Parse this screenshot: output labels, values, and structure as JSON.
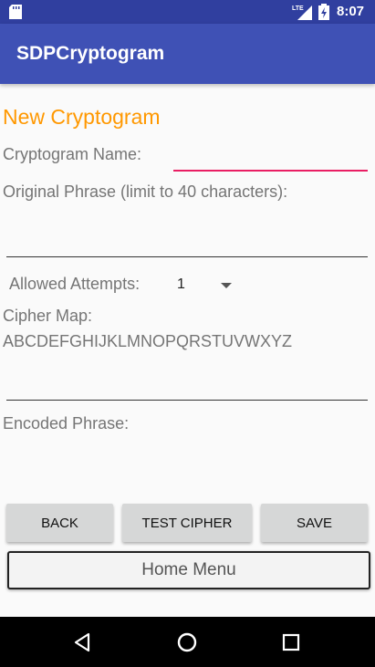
{
  "status_bar": {
    "time": "8:07",
    "icons": [
      "sd-card-icon",
      "lte-signal-icon",
      "battery-icon"
    ],
    "background": "#303f9f"
  },
  "app_bar": {
    "title": "SDPCryptogram",
    "background": "#3f51b5"
  },
  "form": {
    "title": "New Cryptogram",
    "title_color": "#ff9800",
    "name_label": "Cryptogram Name:",
    "name_value": "",
    "phrase_label": "Original Phrase (limit to 40 characters):",
    "phrase_value": "",
    "attempts_label": "Allowed Attempts:",
    "attempts_value": "1",
    "cipher_label": "Cipher Map:",
    "cipher_alphabet": "ABCDEFGHIJKLMNOPQRSTUVWXYZ",
    "cipher_value": "",
    "encoded_label": "Encoded Phrase:",
    "encoded_value": ""
  },
  "buttons": {
    "back": "BACK",
    "test_cipher": "TEST CIPHER",
    "save": "SAVE",
    "home_menu": "Home Menu"
  },
  "nav_bar": {
    "icons": [
      "back-icon",
      "home-icon",
      "recents-icon"
    ]
  }
}
